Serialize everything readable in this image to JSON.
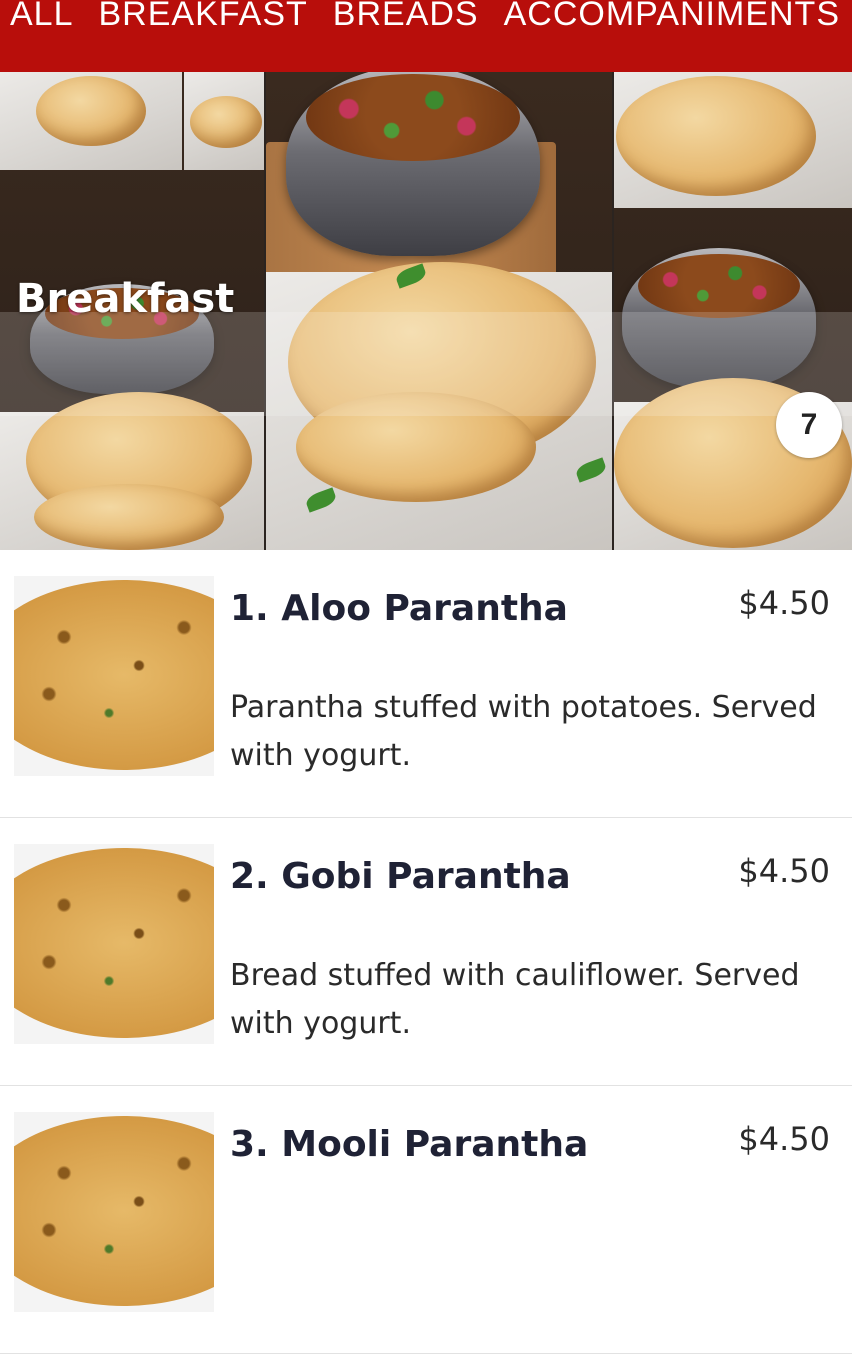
{
  "categories": [
    "ALL",
    "BREAKFAST",
    "BREADS",
    "ACCOMPANIMENTS"
  ],
  "hero": {
    "title": "Breakfast",
    "item_count": "7"
  },
  "menu_items": [
    {
      "name": "1. Aloo Parantha",
      "price": "$4.50",
      "description": "Parantha stuffed with potatoes. Served with yogurt.",
      "image": "aloo-parantha-photo"
    },
    {
      "name": "2. Gobi Parantha",
      "price": "$4.50",
      "description": "Bread stuffed with cauliflower. Served with yogurt.",
      "image": "gobi-parantha-photo"
    },
    {
      "name": "3. Mooli Parantha",
      "price": "$4.50",
      "description": "",
      "image": "mooli-parantha-photo"
    }
  ],
  "colors": {
    "brand_red": "#b80e0b",
    "title_navy": "#1f2235"
  }
}
